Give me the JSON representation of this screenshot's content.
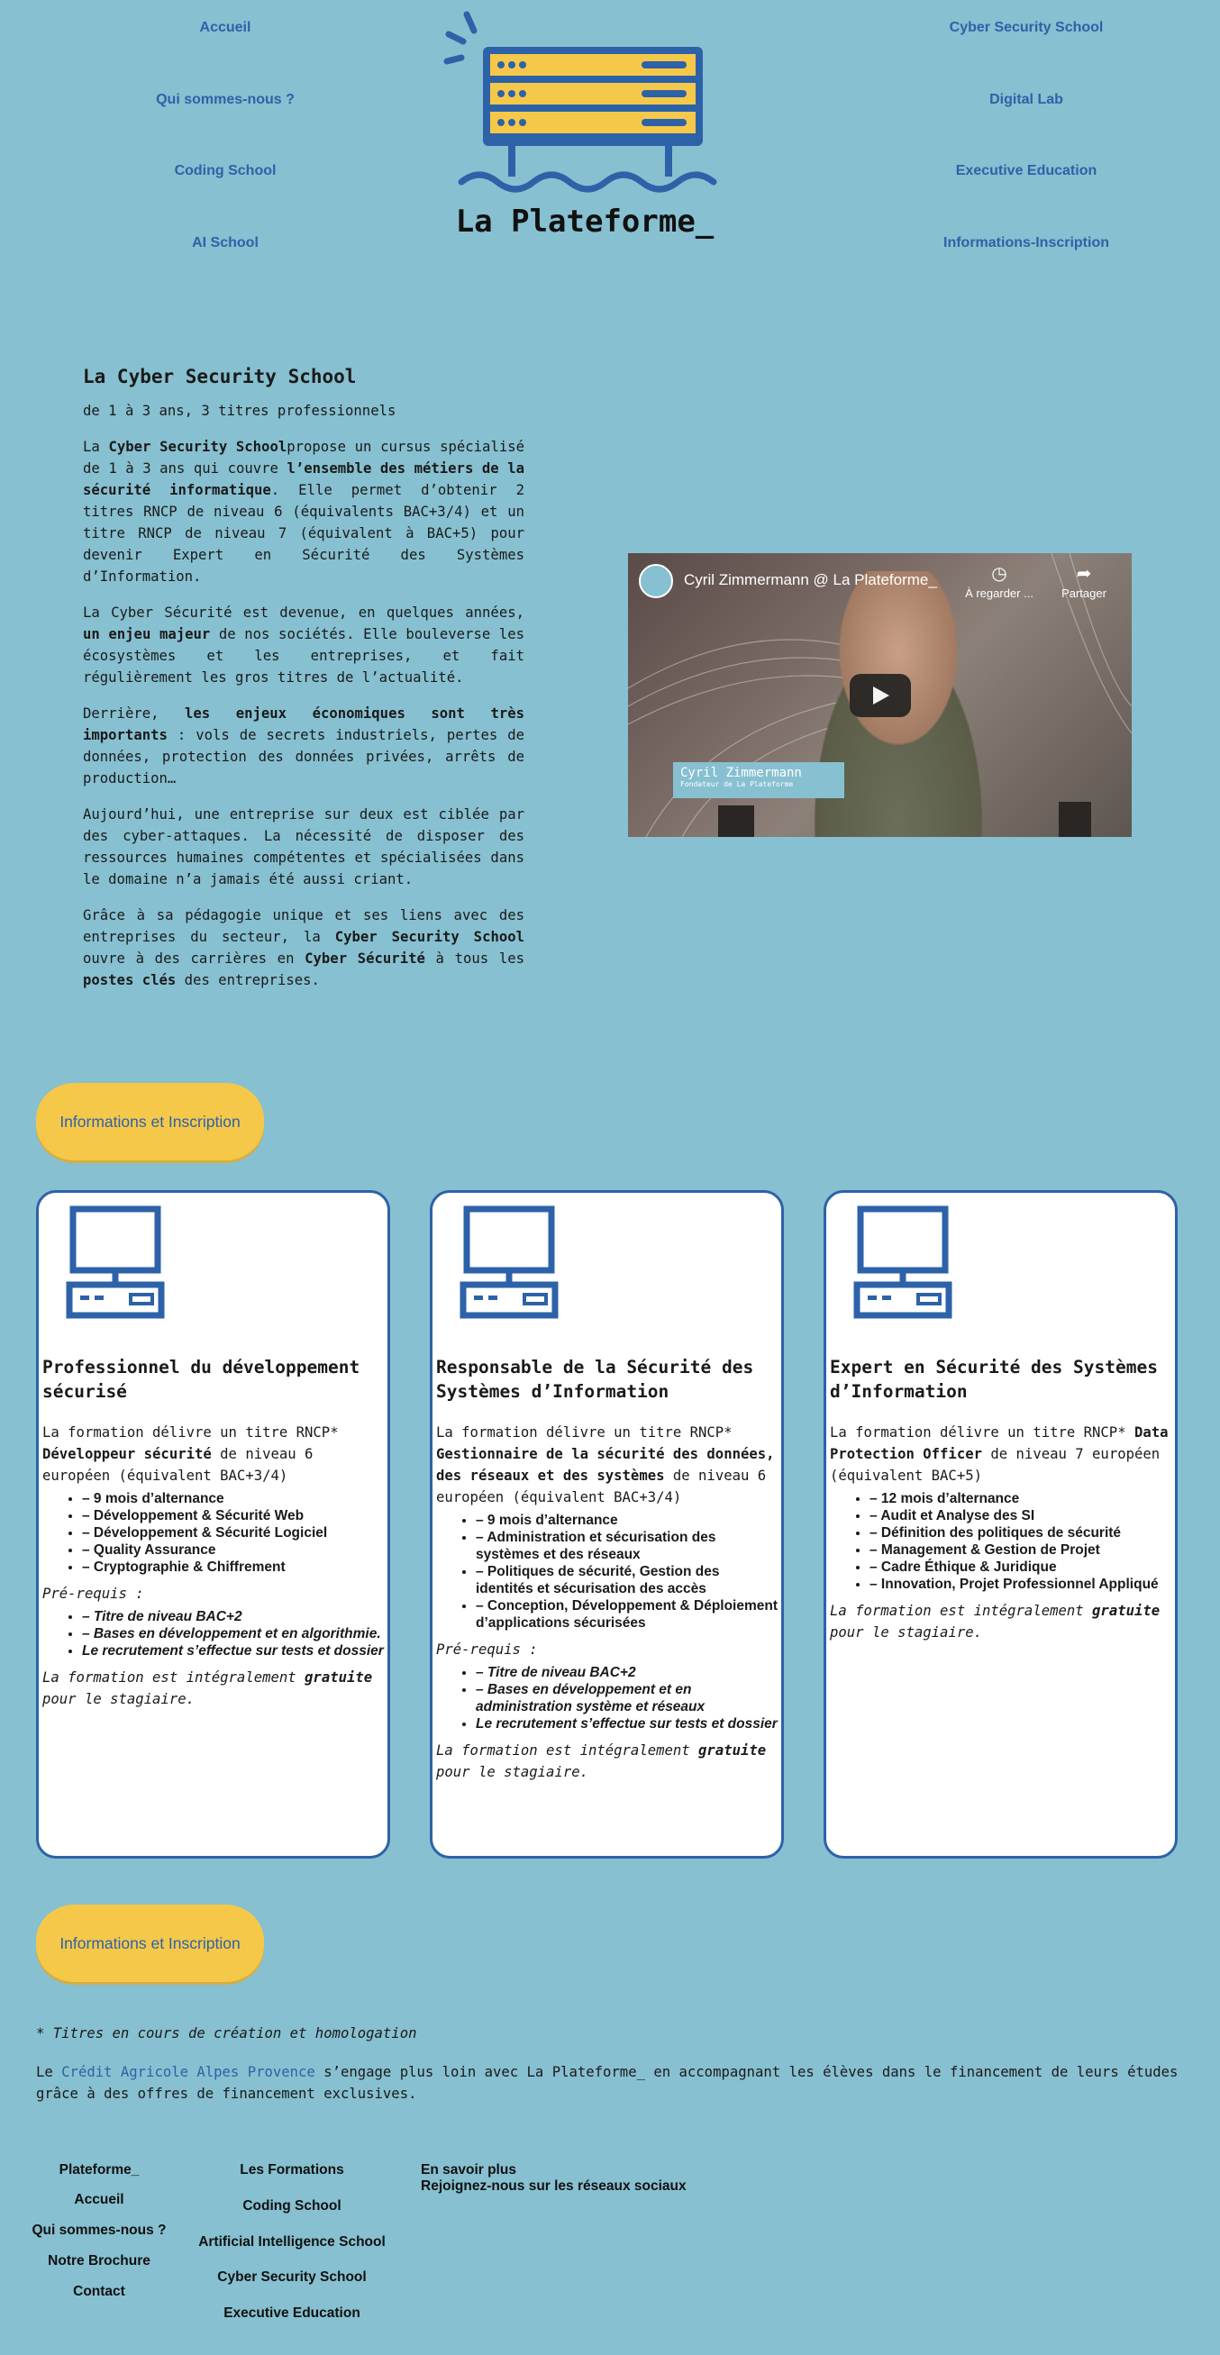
{
  "nav": {
    "left": [
      "Accueil",
      "Qui sommes-nous ?",
      "Coding School",
      "AI School"
    ],
    "right": [
      "Cyber Security School",
      "Digital Lab",
      "Executive Education",
      "Informations-Inscription"
    ]
  },
  "logo": {
    "text": "La Plateforme_",
    "icon": "server-rack-logo-icon"
  },
  "intro": {
    "title": "La Cyber Security School",
    "subtitle": "de 1 à 3 ans, 3 titres professionnels",
    "p1": {
      "a": "La ",
      "b": "Cyber Security School",
      "c": "propose un cursus spécialisé de 1 à 3 ans qui couvre ",
      "d": "l’ensemble des métiers de la sécurité informatique",
      "e": ". Elle permet d’obtenir 2 titres RNCP de niveau 6 (équivalents BAC+3/4) et un titre RNCP de niveau 7 (équivalent à BAC+5) pour devenir Expert en Sécurité des Systèmes d’Information."
    },
    "p2": {
      "a": "La Cyber Sécurité est devenue, en quelques années, ",
      "b": "un enjeu majeur",
      "c": " de nos sociétés. Elle bouleverse les écosystèmes et les entreprises, et fait régulièrement les gros titres de l’actualité."
    },
    "p3": {
      "a": "Derrière, ",
      "b": "les enjeux économiques sont très importants",
      "c": " : vols de secrets industriels, pertes de données, protection des données privées, arrêts de production…"
    },
    "p4": "Aujourd’hui, une entreprise sur deux est ciblée par des cyber-attaques. La nécessité de disposer des ressources humaines compétentes et spécialisées dans le domaine n’a jamais été aussi criant.",
    "p5": {
      "a": "Grâce à sa pédagogie unique et ses liens avec des entreprises du secteur, la ",
      "b": "Cyber Security School",
      "c": " ouvre à des carrières en ",
      "d": "Cyber Sécurité",
      "e": " à tous les ",
      "f": "postes clés",
      "g": " des entreprises."
    }
  },
  "video": {
    "title": "Cyril Zimmermann @ La Plateforme_",
    "watch_later": "À regarder ...",
    "share": "Partager",
    "caption_name": "Cyril Zimmermann",
    "caption_role": "Fondateur de La Plateforme"
  },
  "cta_label": "Informations et Inscription",
  "cards": [
    {
      "title": "Professionnel du développement sécurisé",
      "intro_a": "La formation délivre un titre RNCP* ",
      "intro_b": "Développeur sécurité",
      "intro_c": " de niveau 6 européen (équivalent BAC+3/4)",
      "items": [
        "– 9 mois d’alternance",
        "– Développement & Sécurité Web",
        "– Développement & Sécurité Logiciel",
        "– Quality Assurance",
        "– Cryptographie & Chiffrement"
      ],
      "prereq_label": "Pré-requis :",
      "prereqs": [
        "– Titre de niveau BAC+2",
        "– Bases en développement et en algorithmie.",
        "Le recrutement s’effectue sur tests et dossier"
      ],
      "free_a": "La formation est intégralement ",
      "free_b": "gratuite",
      "free_c": " pour le stagiaire."
    },
    {
      "title": "Responsable de la Sécurité des Systèmes d’Information",
      "intro_a": "La formation délivre un titre RNCP* ",
      "intro_b": "Gestionnaire de la sécurité des données, des réseaux et des systèmes",
      "intro_c": " de niveau 6 européen (équivalent BAC+3/4)",
      "items": [
        "– 9 mois d’alternance",
        "– Administration et sécurisation des systèmes et des réseaux",
        "– Politiques de sécurité, Gestion des identités et sécurisation des accès",
        "– Conception, Développement & Déploiement d’applications sécurisées"
      ],
      "prereq_label": "Pré-requis :",
      "prereqs": [
        "– Titre de niveau BAC+2",
        "– Bases en développement et en administration système et réseaux",
        "Le recrutement s’effectue sur tests et dossier"
      ],
      "free_a": "La formation est intégralement ",
      "free_b": "gratuite",
      "free_c": " pour le stagiaire."
    },
    {
      "title": "Expert en Sécurité des Systèmes d’Information",
      "intro_a": "La formation délivre un titre RNCP* ",
      "intro_b": "Data Protection Officer",
      "intro_c": " de niveau 7 européen (équivalent BAC+5)",
      "items": [
        "– 12 mois d’alternance",
        "– Audit et Analyse des SI",
        "– Définition des politiques de sécurité",
        "– Management & Gestion de Projet",
        "– Cadre Éthique & Juridique",
        "– Innovation, Projet Professionnel Appliqué"
      ],
      "free_a": "La formation est intégralement ",
      "free_b": "gratuite",
      "free_c": " pour le stagiaire."
    }
  ],
  "footnote": "* Titres en cours de création et homologation",
  "credit": {
    "a": "Le ",
    "link": "Crédit Agricole Alpes Provence",
    "b": " s’engage plus loin avec La Plateforme_ en accompagnant les élèves dans le financement de leurs études grâce à des offres de financement exclusives."
  },
  "footer": {
    "col1": [
      "Plateforme_",
      "Accueil",
      "Qui sommes-nous ?",
      "Notre Brochure",
      "Contact"
    ],
    "col2": [
      "Les Formations",
      "Coding School",
      "Artificial Intelligence School",
      "Cyber Security School",
      "Executive Education"
    ],
    "col3": [
      "En savoir plus",
      "Rejoignez-nous sur les réseaux sociaux"
    ]
  },
  "colors": {
    "background": "#87c0d0",
    "accent": "#2d62a8",
    "cta": "#f5c84a"
  }
}
